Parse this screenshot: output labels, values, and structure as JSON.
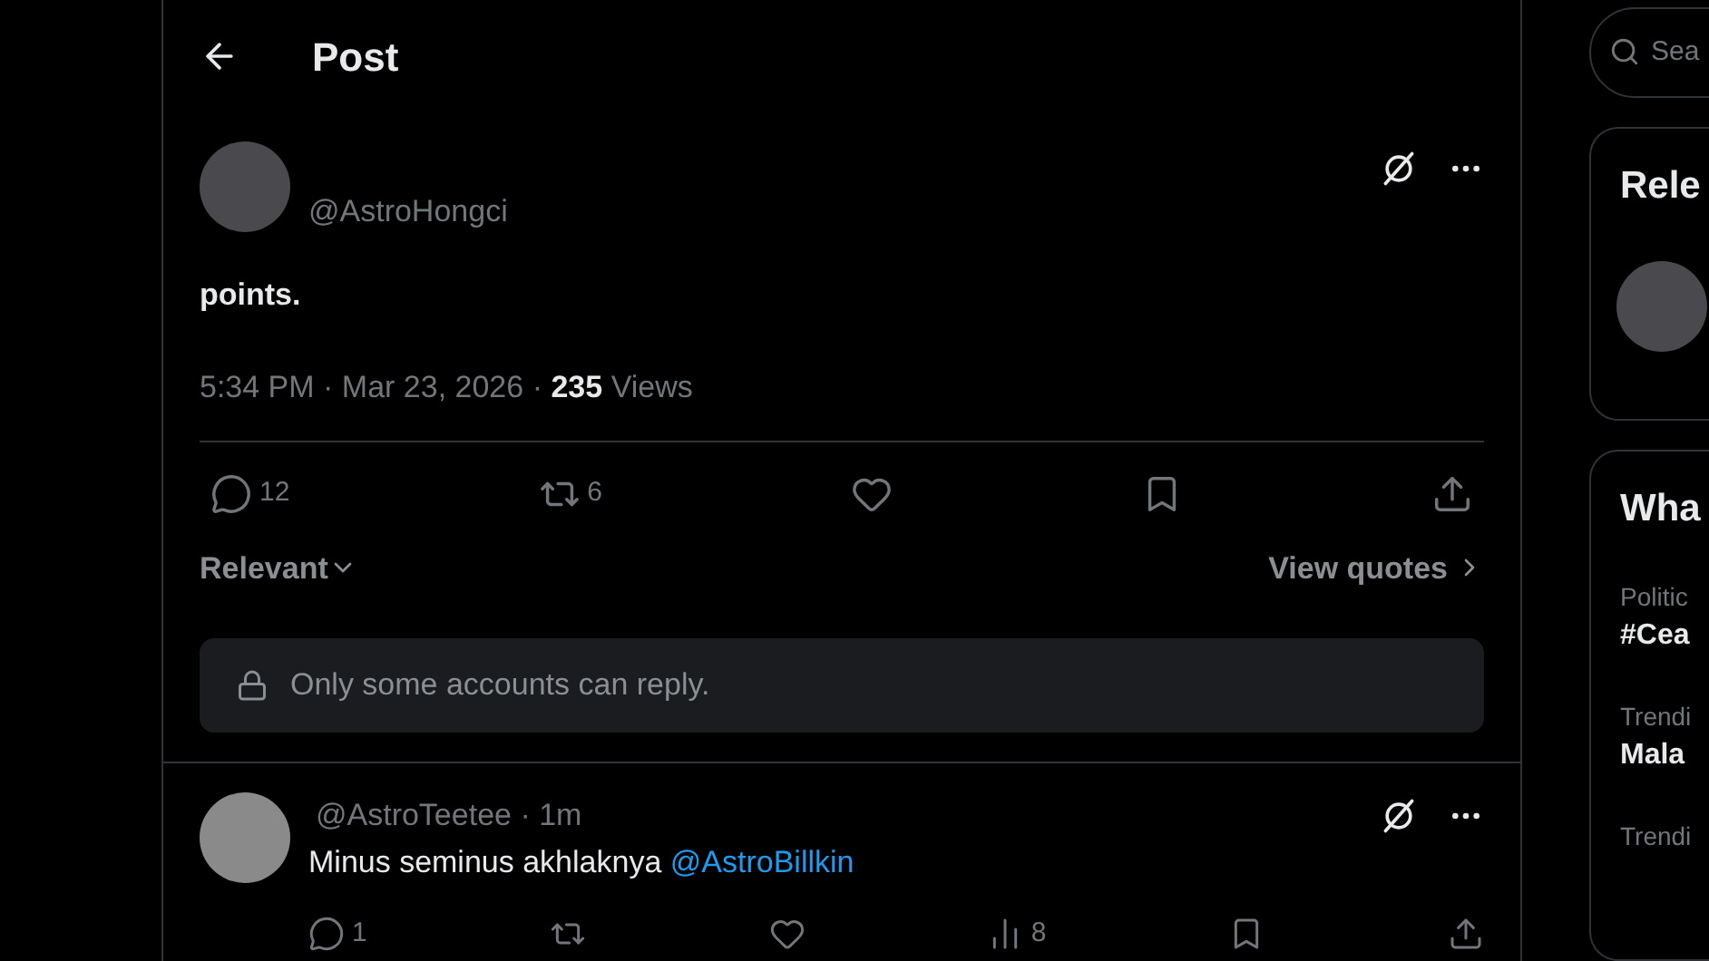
{
  "header": {
    "title": "Post"
  },
  "post": {
    "handle": "@AstroHongci",
    "text": "points.",
    "timestamp": "5:34 PM · Mar 23, 2026 · ",
    "views_count": "235",
    "views_label": "Views",
    "actions": [
      {
        "kind": "reply",
        "count": "12"
      },
      {
        "kind": "repost",
        "count": "6"
      },
      {
        "kind": "like"
      },
      {
        "kind": "bookmark"
      },
      {
        "kind": "share"
      }
    ],
    "sort": "Relevant",
    "quotes_link": "View quotes",
    "reply_restriction": "Only some accounts can reply."
  },
  "replies": [
    {
      "handle": "@AstroTeetee",
      "time": "· 1m",
      "text": "Minus seminus akhlaknya",
      "mention": "@AstroBillkin",
      "actions": [
        {
          "kind": "reply",
          "count": "1"
        },
        {
          "kind": "repost"
        },
        {
          "kind": "like"
        },
        {
          "kind": "views",
          "count": "8"
        },
        {
          "kind": "bookmark"
        },
        {
          "kind": "share"
        }
      ]
    }
  ],
  "sidebar": {
    "search": {
      "placeholder": "Sea"
    },
    "relevant_title": "Rele",
    "trends_title": "Wha",
    "trends": [
      {
        "category": "Politic",
        "name": "#Cea"
      },
      {
        "category": "Trendi",
        "name": "Mala"
      },
      {
        "category": "Trendi"
      }
    ]
  }
}
